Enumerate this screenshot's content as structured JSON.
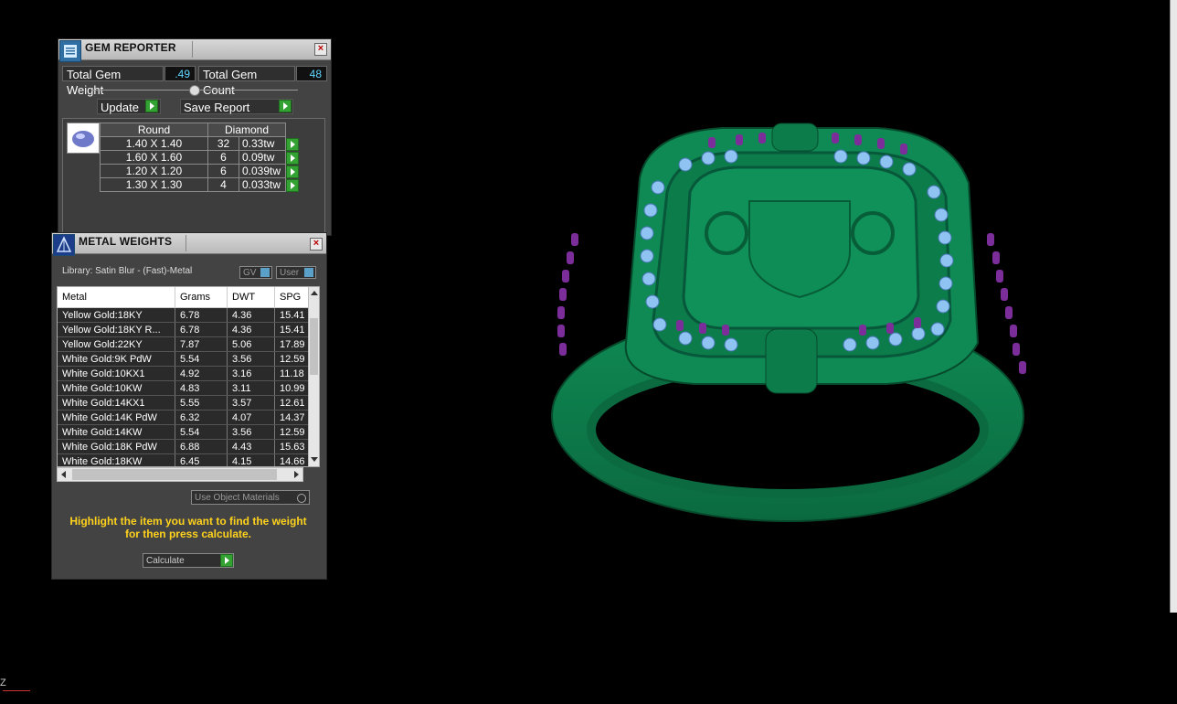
{
  "gem_reporter": {
    "title": "GEM REPORTER",
    "total_weight_label": "Total Gem Weight",
    "total_weight_value": ".49",
    "total_count_label": "Total Gem Count",
    "total_count_value": "48",
    "update_label": "Update",
    "save_report_label": "Save Report",
    "shape_header": "Round",
    "material_header": "Diamond",
    "rows": [
      {
        "size": "1.40 X 1.40",
        "count": "32",
        "weight": "0.33tw"
      },
      {
        "size": "1.60 X 1.60",
        "count": "6",
        "weight": "0.09tw"
      },
      {
        "size": "1.20 X 1.20",
        "count": "6",
        "weight": "0.039tw"
      },
      {
        "size": "1.30 X 1.30",
        "count": "4",
        "weight": "0.033tw"
      }
    ]
  },
  "metal_weights": {
    "title": "METAL WEIGHTS",
    "library_label": "Library: Satin Blur - (Fast)-Metal",
    "gv_label": "GV",
    "user_label": "User",
    "columns": [
      "Metal",
      "Grams",
      "DWT",
      "SPG"
    ],
    "rows": [
      [
        "Yellow Gold:18KY",
        "6.78",
        "4.36",
        "15.41"
      ],
      [
        "Yellow Gold:18KY R...",
        "6.78",
        "4.36",
        "15.41"
      ],
      [
        "Yellow Gold:22KY",
        "7.87",
        "5.06",
        "17.89"
      ],
      [
        "White Gold:9K PdW",
        "5.54",
        "3.56",
        "12.59"
      ],
      [
        "White Gold:10KX1",
        "4.92",
        "3.16",
        "11.18"
      ],
      [
        "White Gold:10KW",
        "4.83",
        "3.11",
        "10.99"
      ],
      [
        "White Gold:14KX1",
        "5.55",
        "3.57",
        "12.61"
      ],
      [
        "White Gold:14K PdW",
        "6.32",
        "4.07",
        "14.37"
      ],
      [
        "White Gold:14KW",
        "5.54",
        "3.56",
        "12.59"
      ],
      [
        "White Gold:18K PdW",
        "6.88",
        "4.43",
        "15.63"
      ],
      [
        "White Gold:18KW",
        "6.45",
        "4.15",
        "14.66"
      ]
    ],
    "use_object_materials_label": "Use Object Materials",
    "hint_line1": "Highlight the item you want to find the weight",
    "hint_line2": "for then press calculate.",
    "calculate_label": "Calculate"
  },
  "viewport": {
    "axis_label": "Z"
  },
  "colors": {
    "ring_green": "#0e7a4a",
    "gem_blue": "#8fc4f2",
    "prong_purple": "#7b2e9a"
  }
}
